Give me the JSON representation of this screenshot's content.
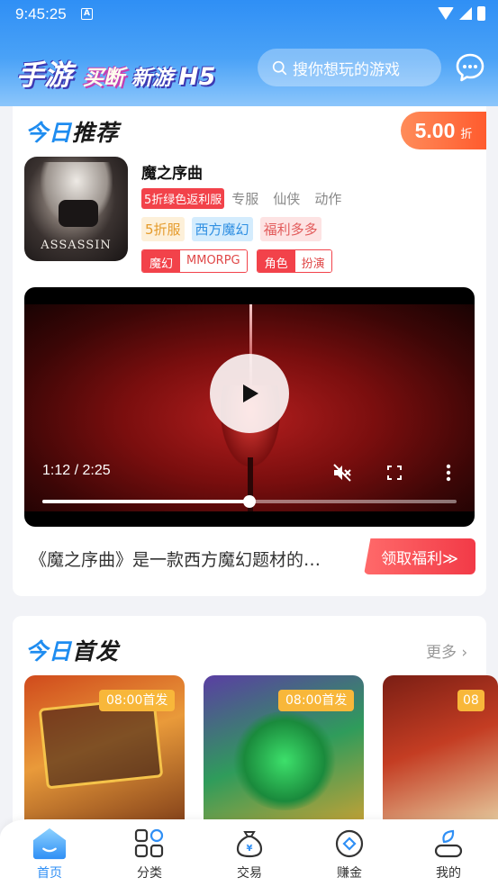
{
  "status_bar": {
    "time": "9:45:25",
    "notif_letter": "A"
  },
  "header": {
    "slogan": [
      "手游",
      "买断",
      "新游",
      "H5"
    ],
    "search_placeholder": "搜你想玩的游戏"
  },
  "recommend": {
    "title_blue": "今日",
    "title_dark": "推荐",
    "discount_value": "5.00",
    "discount_unit": "折",
    "game": {
      "name": "魔之序曲",
      "icon_brand": "ASSASSIN",
      "tag_highlight": "5折绿色返利服",
      "tags_plain": [
        "专服",
        "仙侠",
        "动作"
      ],
      "pills": [
        "5折服",
        "西方魔幻",
        "福利多多"
      ],
      "duo_tags": [
        {
          "left": "魔幻",
          "right": "MMORPG"
        },
        {
          "left": "角色",
          "right": "扮演"
        }
      ]
    },
    "video": {
      "time": "1:12 / 2:25",
      "progress": 0.5
    },
    "description": "《魔之序曲》是一款西方魔幻题材的…",
    "claim_button": "领取福利≫"
  },
  "first_launch": {
    "title_blue": "今日",
    "title_dark": "首发",
    "more": "更多 ›",
    "games": [
      {
        "badge": "08:00首发"
      },
      {
        "badge": "08:00首发"
      },
      {
        "badge": "08"
      }
    ]
  },
  "tabbar": {
    "tabs": [
      {
        "label": "首页",
        "icon": "home-icon",
        "active": true
      },
      {
        "label": "分类",
        "icon": "grid-icon",
        "active": false
      },
      {
        "label": "交易",
        "icon": "money-bag-icon",
        "active": false
      },
      {
        "label": "赚金",
        "icon": "coin-icon",
        "active": false
      },
      {
        "label": "我的",
        "icon": "user-icon",
        "active": false
      }
    ]
  },
  "colors": {
    "accent_blue": "#2f8ff5",
    "accent_red": "#f2424a",
    "discount_orange": "#ff5b2e",
    "badge_yellow": "#f8b73a"
  }
}
